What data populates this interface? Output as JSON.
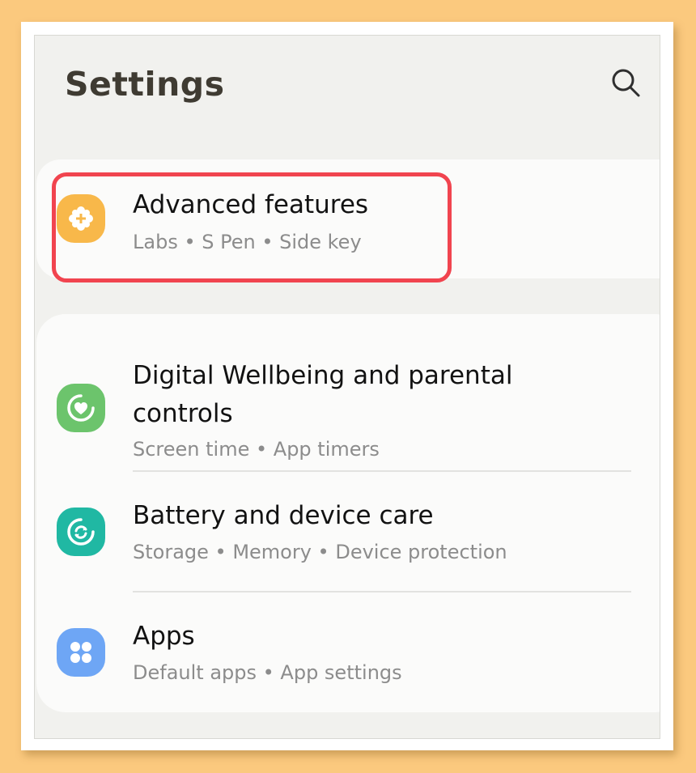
{
  "header": {
    "title": "Settings",
    "search_icon": "search-icon"
  },
  "colors": {
    "background": "#fbc97e",
    "highlight": "#f1444f",
    "advanced_icon": "#f8b84a",
    "wellbeing_icon": "#6cc46c",
    "battery_icon": "#20b8a3",
    "apps_icon": "#6ea6f5"
  },
  "advanced": {
    "title": "Advanced features",
    "sub": "Labs  •  S Pen  •  Side key",
    "icon": "puzzle-gear-icon"
  },
  "items": [
    {
      "title_line1": "Digital Wellbeing and parental",
      "title_line2": "controls",
      "sub": "Screen time  •  App timers",
      "icon": "wellbeing-heart-icon"
    },
    {
      "title": "Battery and device care",
      "sub": "Storage  •  Memory  •  Device protection",
      "icon": "device-care-icon"
    },
    {
      "title": "Apps",
      "sub": "Default apps  •  App settings",
      "icon": "apps-grid-icon"
    }
  ]
}
